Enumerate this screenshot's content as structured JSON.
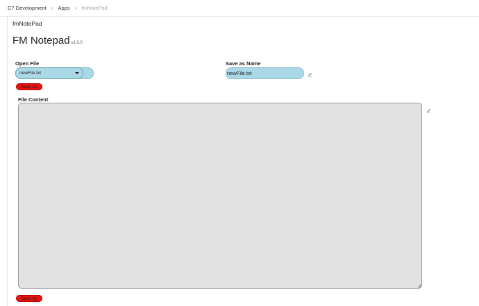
{
  "breadcrumb": {
    "items": [
      "C7 Development",
      "Apps",
      "fmNotePad"
    ],
    "separator": "›"
  },
  "app": {
    "name": "fmNotePad",
    "title": "FM Notepad",
    "version": "v1.0.0"
  },
  "open_file": {
    "label": "Open File",
    "selected": "newFile.txt"
  },
  "save_as_name": {
    "label": "Save as Name",
    "value": "newFile.txt"
  },
  "content": {
    "label": "File Content",
    "value": ""
  },
  "buttons": {
    "save_as_top": "Save As",
    "save_as_bottom": "Save As"
  },
  "icons": {
    "name_edit": "pencil-icon",
    "content_edit": "pencil-icon",
    "dropdown": "caret-down-icon"
  },
  "colors": {
    "input_bg": "#aad8e6",
    "button_bg": "#e81010",
    "textarea_bg": "#e2e2e2"
  }
}
